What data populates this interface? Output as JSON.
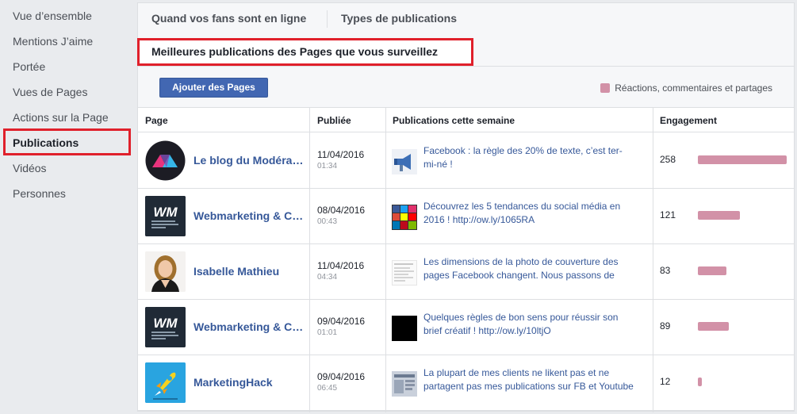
{
  "sidebar": {
    "items": [
      {
        "label": "Vue d’ensemble"
      },
      {
        "label": "Mentions J’aime"
      },
      {
        "label": "Portée"
      },
      {
        "label": "Vues de Pages"
      },
      {
        "label": "Actions sur la Page"
      },
      {
        "label": "Publications"
      },
      {
        "label": "Vidéos"
      },
      {
        "label": "Personnes"
      }
    ],
    "active_index": 5
  },
  "tabs": [
    {
      "label": "Quand vos fans sont en ligne"
    },
    {
      "label": "Types de publications"
    }
  ],
  "section_title": "Meilleures publications des Pages que vous surveillez",
  "add_pages_button": "Ajouter des Pages",
  "legend_label": "Réactions, commentaires et partages",
  "accent_color": "#d291a7",
  "highlight_color": "#e0202b",
  "table": {
    "headers": {
      "page": "Page",
      "published": "Publiée",
      "posts": "Publications cette semaine",
      "engagement": "Engagement"
    },
    "max_engagement": 258,
    "rows": [
      {
        "page": "Le blog du Modérateur",
        "date": "11/04/2016",
        "time": "01:34",
        "post": "Facebook : la règle des 20% de texte, c’est ter-mi-né !",
        "engagement": "258",
        "avatar": "blogdumoderateur-logo",
        "thumb": "megaphone-thumb"
      },
      {
        "page": "Webmarketing & Com",
        "date": "08/04/2016",
        "time": "00:43",
        "post": "Découvrez les 5 tendances du social média en 2016 ! http://ow.ly/1065RA",
        "engagement": "121",
        "avatar": "wm-logo",
        "thumb": "social-icons-thumb"
      },
      {
        "page": "Isabelle Mathieu",
        "date": "11/04/2016",
        "time": "04:34",
        "post": "Les dimensions de la photo de couverture des pages Facebook changent. Nous passons de",
        "engagement": "83",
        "avatar": "person-photo",
        "thumb": "document-thumb"
      },
      {
        "page": "Webmarketing & Com",
        "date": "09/04/2016",
        "time": "01:01",
        "post": "Quelques règles de bon sens pour réussir son brief créatif ! http://ow.ly/10ltjO",
        "engagement": "89",
        "avatar": "wm-logo",
        "thumb": "black-thumb"
      },
      {
        "page": "MarketingHack",
        "date": "09/04/2016",
        "time": "06:45",
        "post": "La plupart de mes clients ne likent pas et ne partagent pas mes publications sur FB et Youtube",
        "engagement": "12",
        "avatar": "rocket-logo",
        "thumb": "blog-thumb"
      }
    ]
  }
}
